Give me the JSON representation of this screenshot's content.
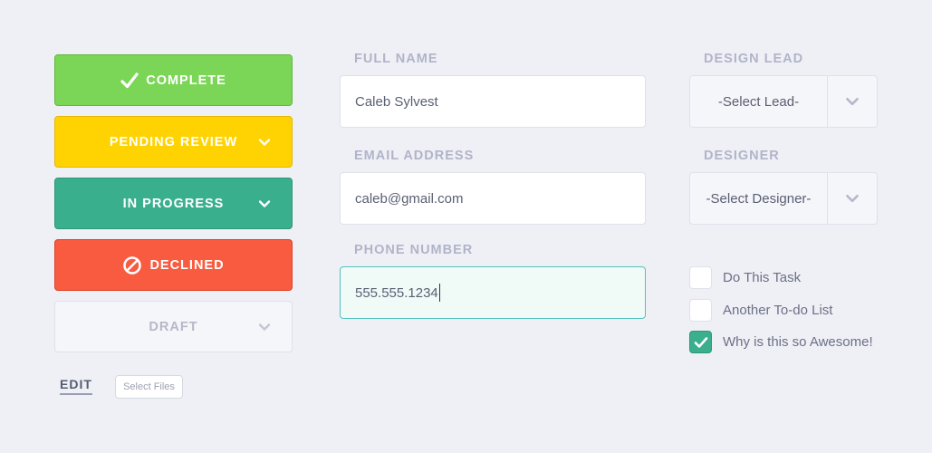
{
  "status_buttons": {
    "complete": "COMPLETE",
    "pending": "PENDING REVIEW",
    "in_progress": "IN PROGRESS",
    "declined": "DECLINED",
    "draft": "DRAFT"
  },
  "actions": {
    "edit": "EDIT",
    "select_files": "Select Files"
  },
  "form": {
    "full_name": {
      "label": "FULL NAME",
      "value": "Caleb Sylvest"
    },
    "email": {
      "label": "EMAIL ADDRESS",
      "value": "caleb@gmail.com"
    },
    "phone": {
      "label": "PHONE NUMBER",
      "value": "555.555.1234"
    }
  },
  "selects": {
    "design_lead": {
      "label": "DESIGN LEAD",
      "value": "-Select Lead-"
    },
    "designer": {
      "label": "DESIGNER",
      "value": "-Select Designer-"
    }
  },
  "todos": [
    {
      "label": "Do This Task",
      "checked": false
    },
    {
      "label": "Another To-do List",
      "checked": false
    },
    {
      "label": "Why is this so Awesome!",
      "checked": true
    }
  ],
  "icons": {
    "complete": "checkmark-icon",
    "declined": "prohibited-icon",
    "dropdown": "chevron-down-icon"
  },
  "colors": {
    "complete": "#7bd657",
    "pending": "#ffd302",
    "in_progress": "#3aaf8e",
    "declined": "#f85b3f",
    "draft": "#f5f6fa",
    "background": "#eff0f6"
  }
}
